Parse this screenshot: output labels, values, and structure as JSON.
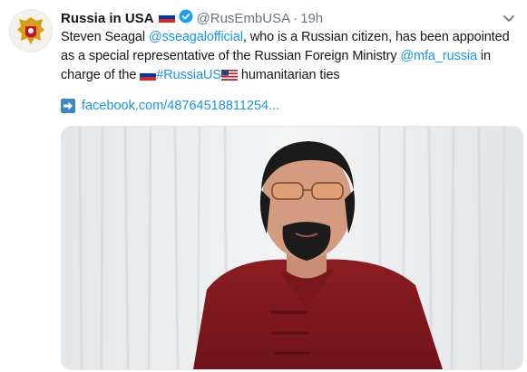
{
  "tweet": {
    "display_name": "Russia in USA",
    "handle": "@RusEmbUSA",
    "separator": "·",
    "time": "19h",
    "text": {
      "part1": "Steven Seagal ",
      "mention1": "@sseagalofficial",
      "part2": ", who is a Russian citizen, has been appointed as a special representative of the Russian Foreign Ministry ",
      "mention2": "@mfa_russia",
      "part3": " in charge of the ",
      "hashtag": "#RussiaUS",
      "part4": " humanitarian ties"
    },
    "link": "facebook.com/48764518811254...",
    "icons": {
      "avatar": "russian-coat-of-arms",
      "verified": "verified-badge-icon",
      "chevron": "chevron-down-icon",
      "link_arrow": "arrow-right-icon"
    },
    "colors": {
      "link": "#1b95e0",
      "secondary_text": "#657786",
      "verified": "#1da1f2"
    }
  }
}
